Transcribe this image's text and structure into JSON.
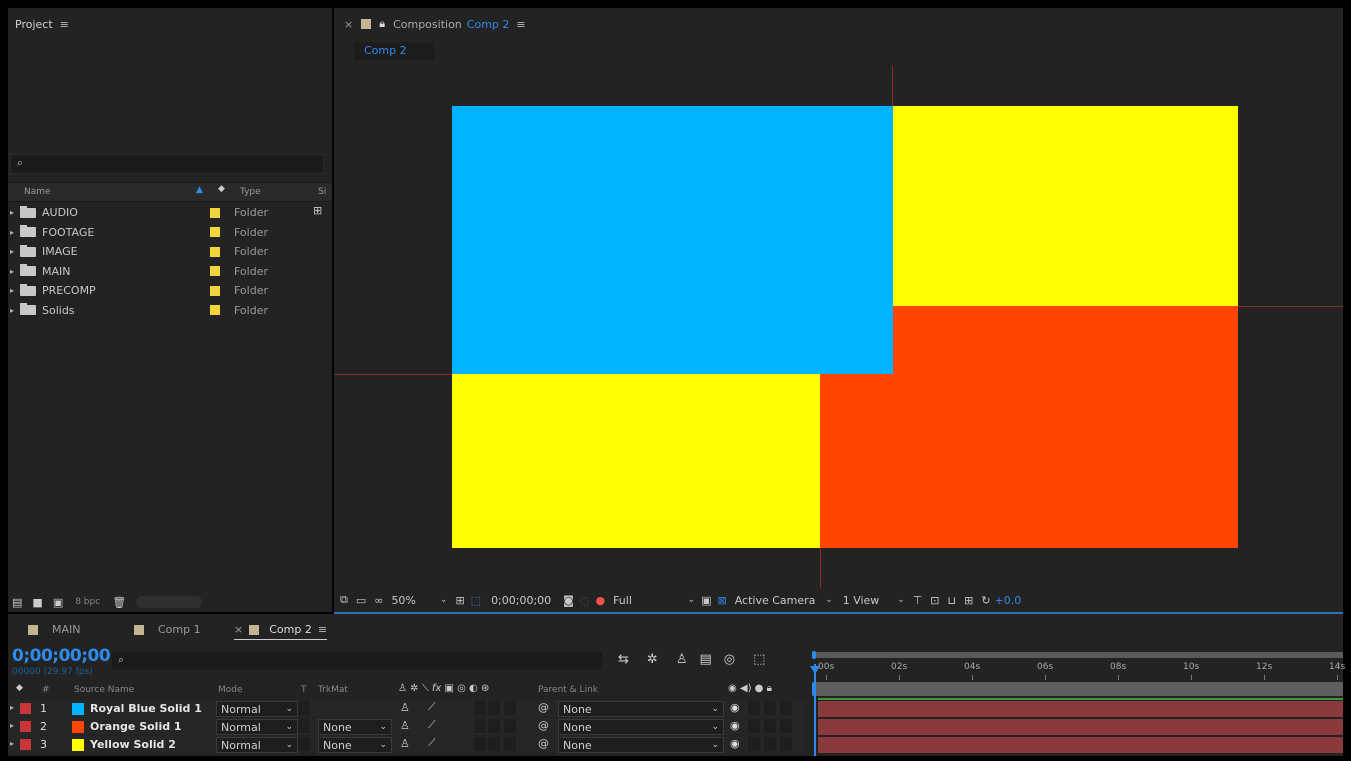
{
  "project": {
    "title": "Project",
    "columns": {
      "name": "Name",
      "type": "Type",
      "size": "Si"
    },
    "items": [
      {
        "name": "AUDIO",
        "type": "Folder"
      },
      {
        "name": "FOOTAGE",
        "type": "Folder"
      },
      {
        "name": "IMAGE",
        "type": "Folder"
      },
      {
        "name": "MAIN",
        "type": "Folder"
      },
      {
        "name": "PRECOMP",
        "type": "Folder"
      },
      {
        "name": "Solids",
        "type": "Folder"
      }
    ],
    "bpc": "8 bpc"
  },
  "composition": {
    "label": "Composition",
    "name": "Comp 2",
    "tab": "Comp 2"
  },
  "viewer": {
    "zoom": "50%",
    "timecode": "0;00;00;00",
    "resolution": "Full",
    "camera": "Active Camera",
    "views": "1 View",
    "exposure": "+0.0",
    "solids": {
      "blue": "#00b4ff",
      "yellow": "#ffff00",
      "orange": "#ff4500"
    }
  },
  "timeline": {
    "tabs": [
      "MAIN",
      "Comp 1",
      "Comp 2"
    ],
    "timecode": "0;00;00;00",
    "frames": "00000 (29.97 fps)",
    "headers": {
      "num": "#",
      "source": "Source Name",
      "mode": "Mode",
      "t": "T",
      "trkmat": "TrkMat",
      "parent": "Parent & Link"
    },
    "ruler": [
      "00s",
      "02s",
      "04s",
      "06s",
      "08s",
      "10s",
      "12s",
      "14s"
    ],
    "layers": [
      {
        "num": "1",
        "name": "Royal Blue Solid 1",
        "color": "#00b4ff",
        "mode": "Normal",
        "trkmat": "",
        "parent": "None"
      },
      {
        "num": "2",
        "name": "Orange Solid 1",
        "color": "#ff4500",
        "mode": "Normal",
        "trkmat": "None",
        "parent": "None"
      },
      {
        "num": "3",
        "name": "Yellow Solid 2",
        "color": "#ffff00",
        "mode": "Normal",
        "trkmat": "None",
        "parent": "None"
      }
    ]
  }
}
